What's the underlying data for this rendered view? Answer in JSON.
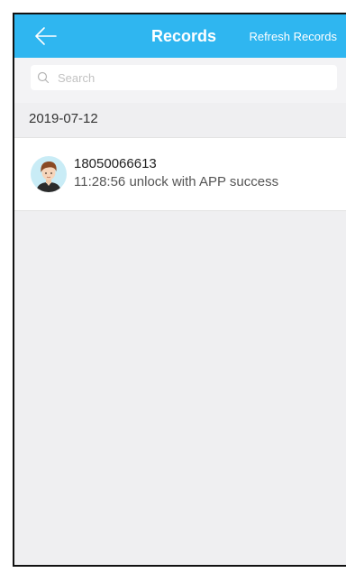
{
  "navbar": {
    "back_icon": "arrow-left-icon",
    "title": "Records",
    "refresh_label": "Refresh Records",
    "bg_color": "#2fb6f0"
  },
  "search": {
    "icon": "search-icon",
    "placeholder": "Search",
    "value": ""
  },
  "records": {
    "date": "2019-07-12",
    "items": [
      {
        "avatar_icon": "user-avatar",
        "name": "18050066613",
        "detail": "11:28:56 unlock with APP success"
      }
    ]
  }
}
